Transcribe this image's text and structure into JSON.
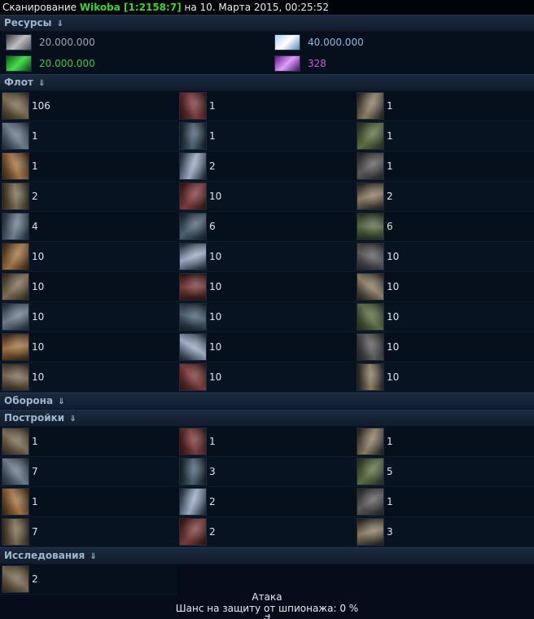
{
  "header": {
    "prefix": "Сканирование",
    "player": "Wikoba",
    "coords": "[1:2158:7]",
    "suffix": "на 10. Марта 2015, 00:25:52"
  },
  "sections": {
    "resources": "Ресурсы",
    "fleet": "Флот",
    "defense": "Оборона",
    "buildings": "Постройки",
    "research": "Исследования",
    "arrow": "⇓"
  },
  "resources": [
    {
      "value": "20.000.000",
      "color": "#a0a6ac",
      "icon": "metal-icon",
      "art": "linear-gradient(135deg,#3a3a3a,#bfbfbf,#505050)"
    },
    {
      "value": "40.000.000",
      "color": "#8fb8d8",
      "icon": "crystal-icon",
      "art": "linear-gradient(135deg,#a7d6ef,#ffffff,#4a88b8)"
    },
    {
      "value": "20.000.000",
      "color": "#3ec94a",
      "icon": "deuterium-icon",
      "art": "linear-gradient(135deg,#0c5a12,#46e04c,#0a3a10)"
    },
    {
      "value": "328",
      "color": "#c85cd8",
      "icon": "energy-icon",
      "art": "linear-gradient(135deg,#5a1a7a,#e29cff,#3a0e55)"
    }
  ],
  "fleet": [
    [
      "106",
      "1",
      "1"
    ],
    [
      "1",
      "1",
      "1"
    ],
    [
      "1",
      "2",
      "1"
    ],
    [
      "2",
      "10",
      "2"
    ],
    [
      "4",
      "6",
      "6"
    ],
    [
      "10",
      "10",
      "10"
    ],
    [
      "10",
      "10",
      "10"
    ],
    [
      "10",
      "10",
      "10"
    ],
    [
      "10",
      "10",
      "10"
    ],
    [
      "10",
      "10",
      "10"
    ]
  ],
  "buildings": [
    [
      "1",
      "1",
      "1"
    ],
    [
      "7",
      "3",
      "5"
    ],
    [
      "1",
      "2",
      "1"
    ],
    [
      "7",
      "2",
      "3"
    ]
  ],
  "research": [
    "2"
  ],
  "footer": {
    "attack": "Атака",
    "chance": "Шанс на защиту от шпионажа: 0 %",
    "more": "Э"
  }
}
